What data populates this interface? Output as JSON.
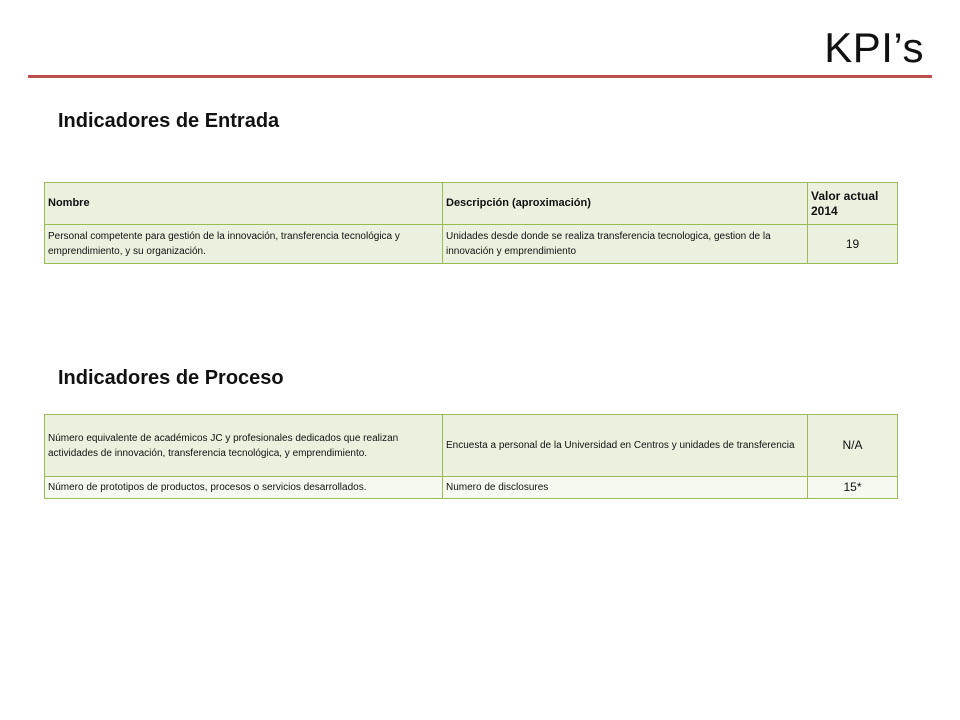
{
  "slide": {
    "title": "KPI’s"
  },
  "sections": {
    "entrada": {
      "heading": "Indicadores de Entrada",
      "columns": [
        "Nombre",
        "Descripción (aproximación)",
        "Valor actual 2014"
      ],
      "rows": [
        {
          "nombre": "Personal competente para gestión de la innovación, transferencia tecnológica y emprendimiento, y su organización.",
          "descripcion": "Unidades desde donde se realiza transferencia tecnologica, gestion de la innovación y emprendimiento",
          "valor": "19"
        }
      ]
    },
    "proceso": {
      "heading": "Indicadores de Proceso",
      "rows": [
        {
          "nombre": "Número equivalente de académicos JC y profesionales dedicados que realizan actividades de innovación, transferencia tecnológica, y emprendimiento.",
          "descripcion": "Encuesta a personal de la Universidad en Centros y unidades de transferencia",
          "valor": "N/A"
        },
        {
          "nombre": "Número de prototipos de productos, procesos o servicios desarrollados.",
          "descripcion": "Numero de disclosures",
          "valor": "15*"
        }
      ]
    }
  },
  "colors": {
    "accent_rule": "#c0504d",
    "table_border": "#9bbb59",
    "table_fill": "#ebf1de"
  }
}
